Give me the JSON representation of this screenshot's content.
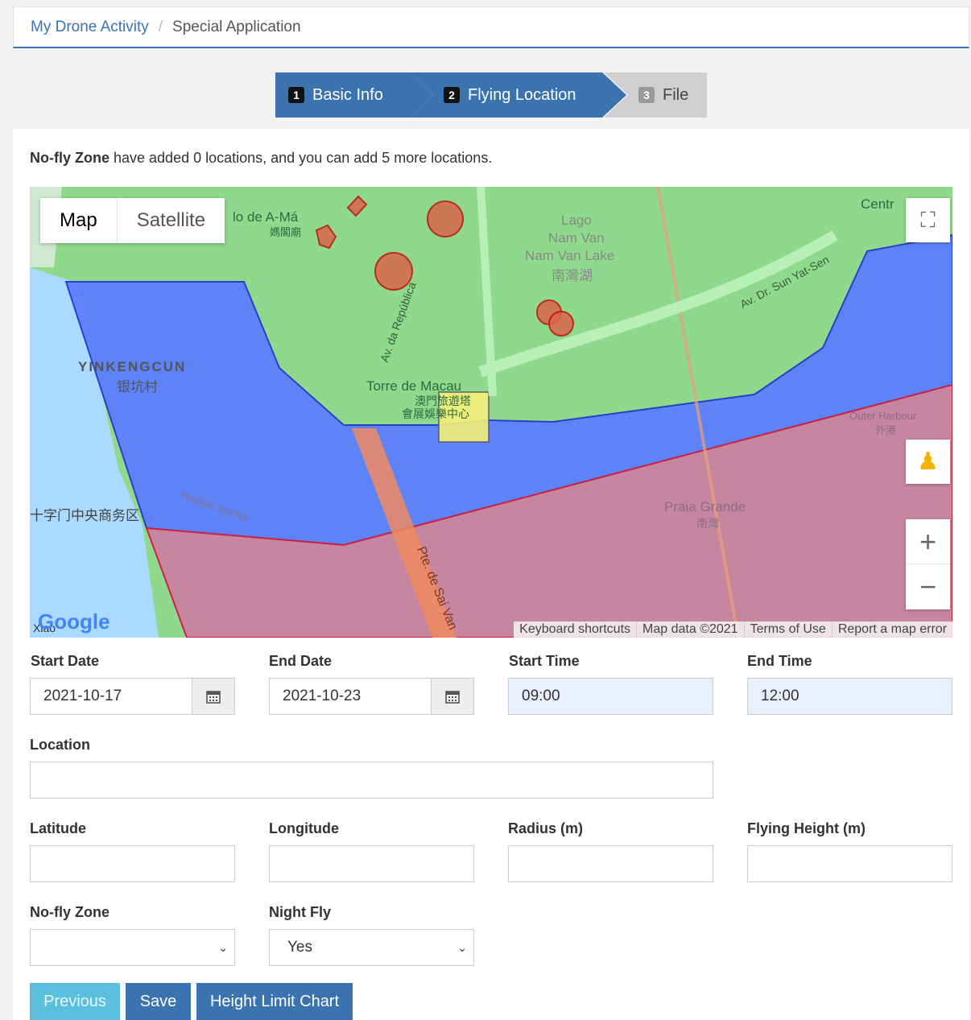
{
  "breadcrumb": {
    "link": "My Drone Activity",
    "separator": "/",
    "current": "Special Application"
  },
  "steps": [
    {
      "num": "1",
      "label": "Basic Info"
    },
    {
      "num": "2",
      "label": "Flying Location"
    },
    {
      "num": "3",
      "label": "File"
    }
  ],
  "notice": {
    "bold": "No-fly Zone",
    "text": " have added 0 locations, and you can add 5 more locations."
  },
  "map": {
    "type_map": "Map",
    "type_satellite": "Satellite",
    "labels": {
      "lago": "Lago",
      "nam_van": "Nam Van",
      "nam_van_lake": "Nam Van Lake",
      "nam_van_zh": "南灣湖",
      "yinkengcun": "YINKENGCUN",
      "yinkengcun_zh": "银坑村",
      "torre": "Torre de Macau",
      "torre_zh1": "澳門旅遊塔",
      "torre_zh2": "會展娛樂中心",
      "praia": "Praia Grande",
      "praia_zh": "南灣",
      "outer_harbour": "Outer Harbour",
      "outer_harbour_zh": "外港",
      "avdr": "Av. Dr. Sun Yat-Sen",
      "avda": "Av. da República",
      "pte": "Pte. de Sai Van",
      "centr": "Centr",
      "amau": "lo de A-Má",
      "amau_zh": "媽閣廟",
      "cbd": "十字门中央商务区",
      "huizhan": "Huizhan 2nd Rd",
      "xiao": "Xiao"
    },
    "attribution": [
      "Keyboard shortcuts",
      "Map data ©2021",
      "Terms of Use",
      "Report a map error"
    ],
    "google": "Google"
  },
  "form": {
    "start_date": {
      "label": "Start Date",
      "value": "2021-10-17"
    },
    "end_date": {
      "label": "End Date",
      "value": "2021-10-23"
    },
    "start_time": {
      "label": "Start Time",
      "value": "09:00"
    },
    "end_time": {
      "label": "End Time",
      "value": "12:00"
    },
    "location": {
      "label": "Location",
      "value": ""
    },
    "latitude": {
      "label": "Latitude",
      "value": ""
    },
    "longitude": {
      "label": "Longitude",
      "value": ""
    },
    "radius": {
      "label": "Radius (m)",
      "value": ""
    },
    "height": {
      "label": "Flying Height (m)",
      "value": ""
    },
    "no_fly_zone": {
      "label": "No-fly Zone",
      "value": ""
    },
    "night_fly": {
      "label": "Night Fly",
      "value": "Yes"
    }
  },
  "buttons": {
    "previous": "Previous",
    "save": "Save",
    "height_chart": "Height Limit Chart"
  },
  "colors": {
    "primary": "#3a73b0",
    "info": "#5bc0de",
    "zone_blue": "#5a7cff",
    "zone_red": "#c7869f"
  }
}
